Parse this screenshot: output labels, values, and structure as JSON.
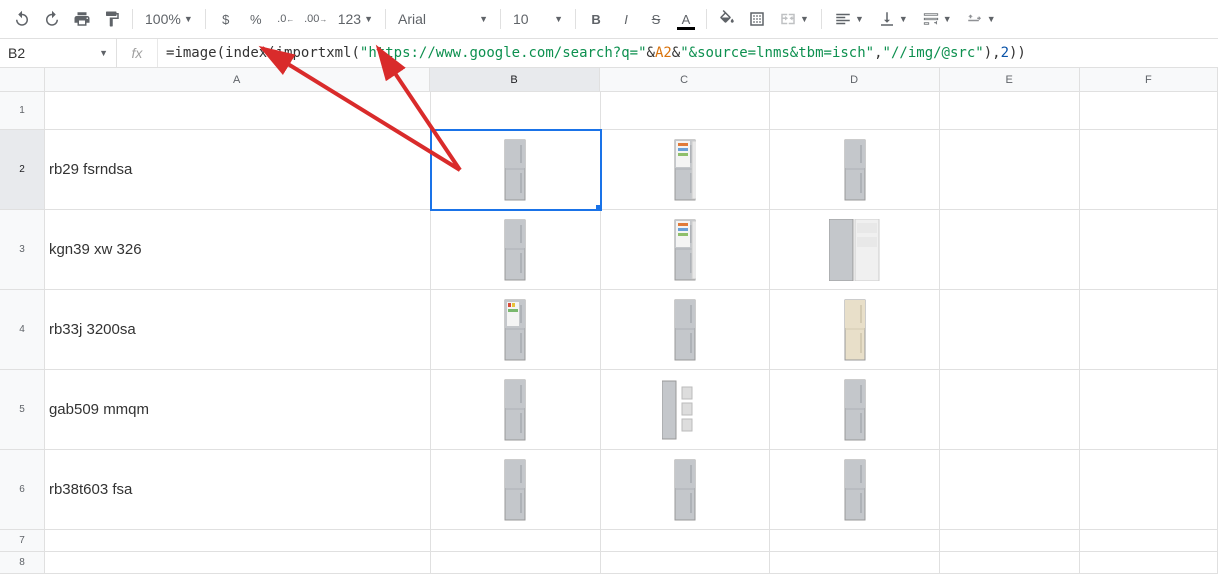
{
  "toolbar": {
    "undo": "↶",
    "redo": "↷",
    "print": "🖶",
    "paint": "🖌",
    "zoom": "100%",
    "currency": "$",
    "percent": "%",
    "dec_dec": ".0←",
    "inc_dec": ".00→",
    "more_formats": "123",
    "font": "Arial",
    "font_size": "10",
    "bold": "B",
    "italic": "I",
    "strike": "S",
    "text_color": "A",
    "fill": "◧",
    "borders": "⊞",
    "merge": "⬚",
    "halign": "≡",
    "valign": "↕",
    "wrap": "↩",
    "rotate": "∠"
  },
  "formula_bar": {
    "cell_ref": "B2",
    "fx": "fx",
    "prefix": "=",
    "func1": "image",
    "func2": "index",
    "func3": "importxml",
    "str1": "\"https://www.google.com/search?q=\"",
    "amp": "&",
    "ref": "A2",
    "str2": "\"&source=lnms&tbm=isch\"",
    "str3": "\"//img/@src\"",
    "num": "2"
  },
  "columns": [
    "A",
    "B",
    "C",
    "D",
    "E",
    "F"
  ],
  "rows": [
    {
      "n": "1",
      "a": "",
      "tall": false,
      "first": true
    },
    {
      "n": "2",
      "a": "rb29 fsrndsa",
      "tall": true
    },
    {
      "n": "3",
      "a": "kgn39 xw 326",
      "tall": true
    },
    {
      "n": "4",
      "a": "rb33j 3200sa",
      "tall": true
    },
    {
      "n": "5",
      "a": "gab509 mmqm",
      "tall": true
    },
    {
      "n": "6",
      "a": "rb38t603 fsa",
      "tall": true
    },
    {
      "n": "7",
      "a": "",
      "tall": false
    },
    {
      "n": "8",
      "a": "",
      "tall": false
    }
  ],
  "selected": {
    "row": "2",
    "col": "B"
  }
}
